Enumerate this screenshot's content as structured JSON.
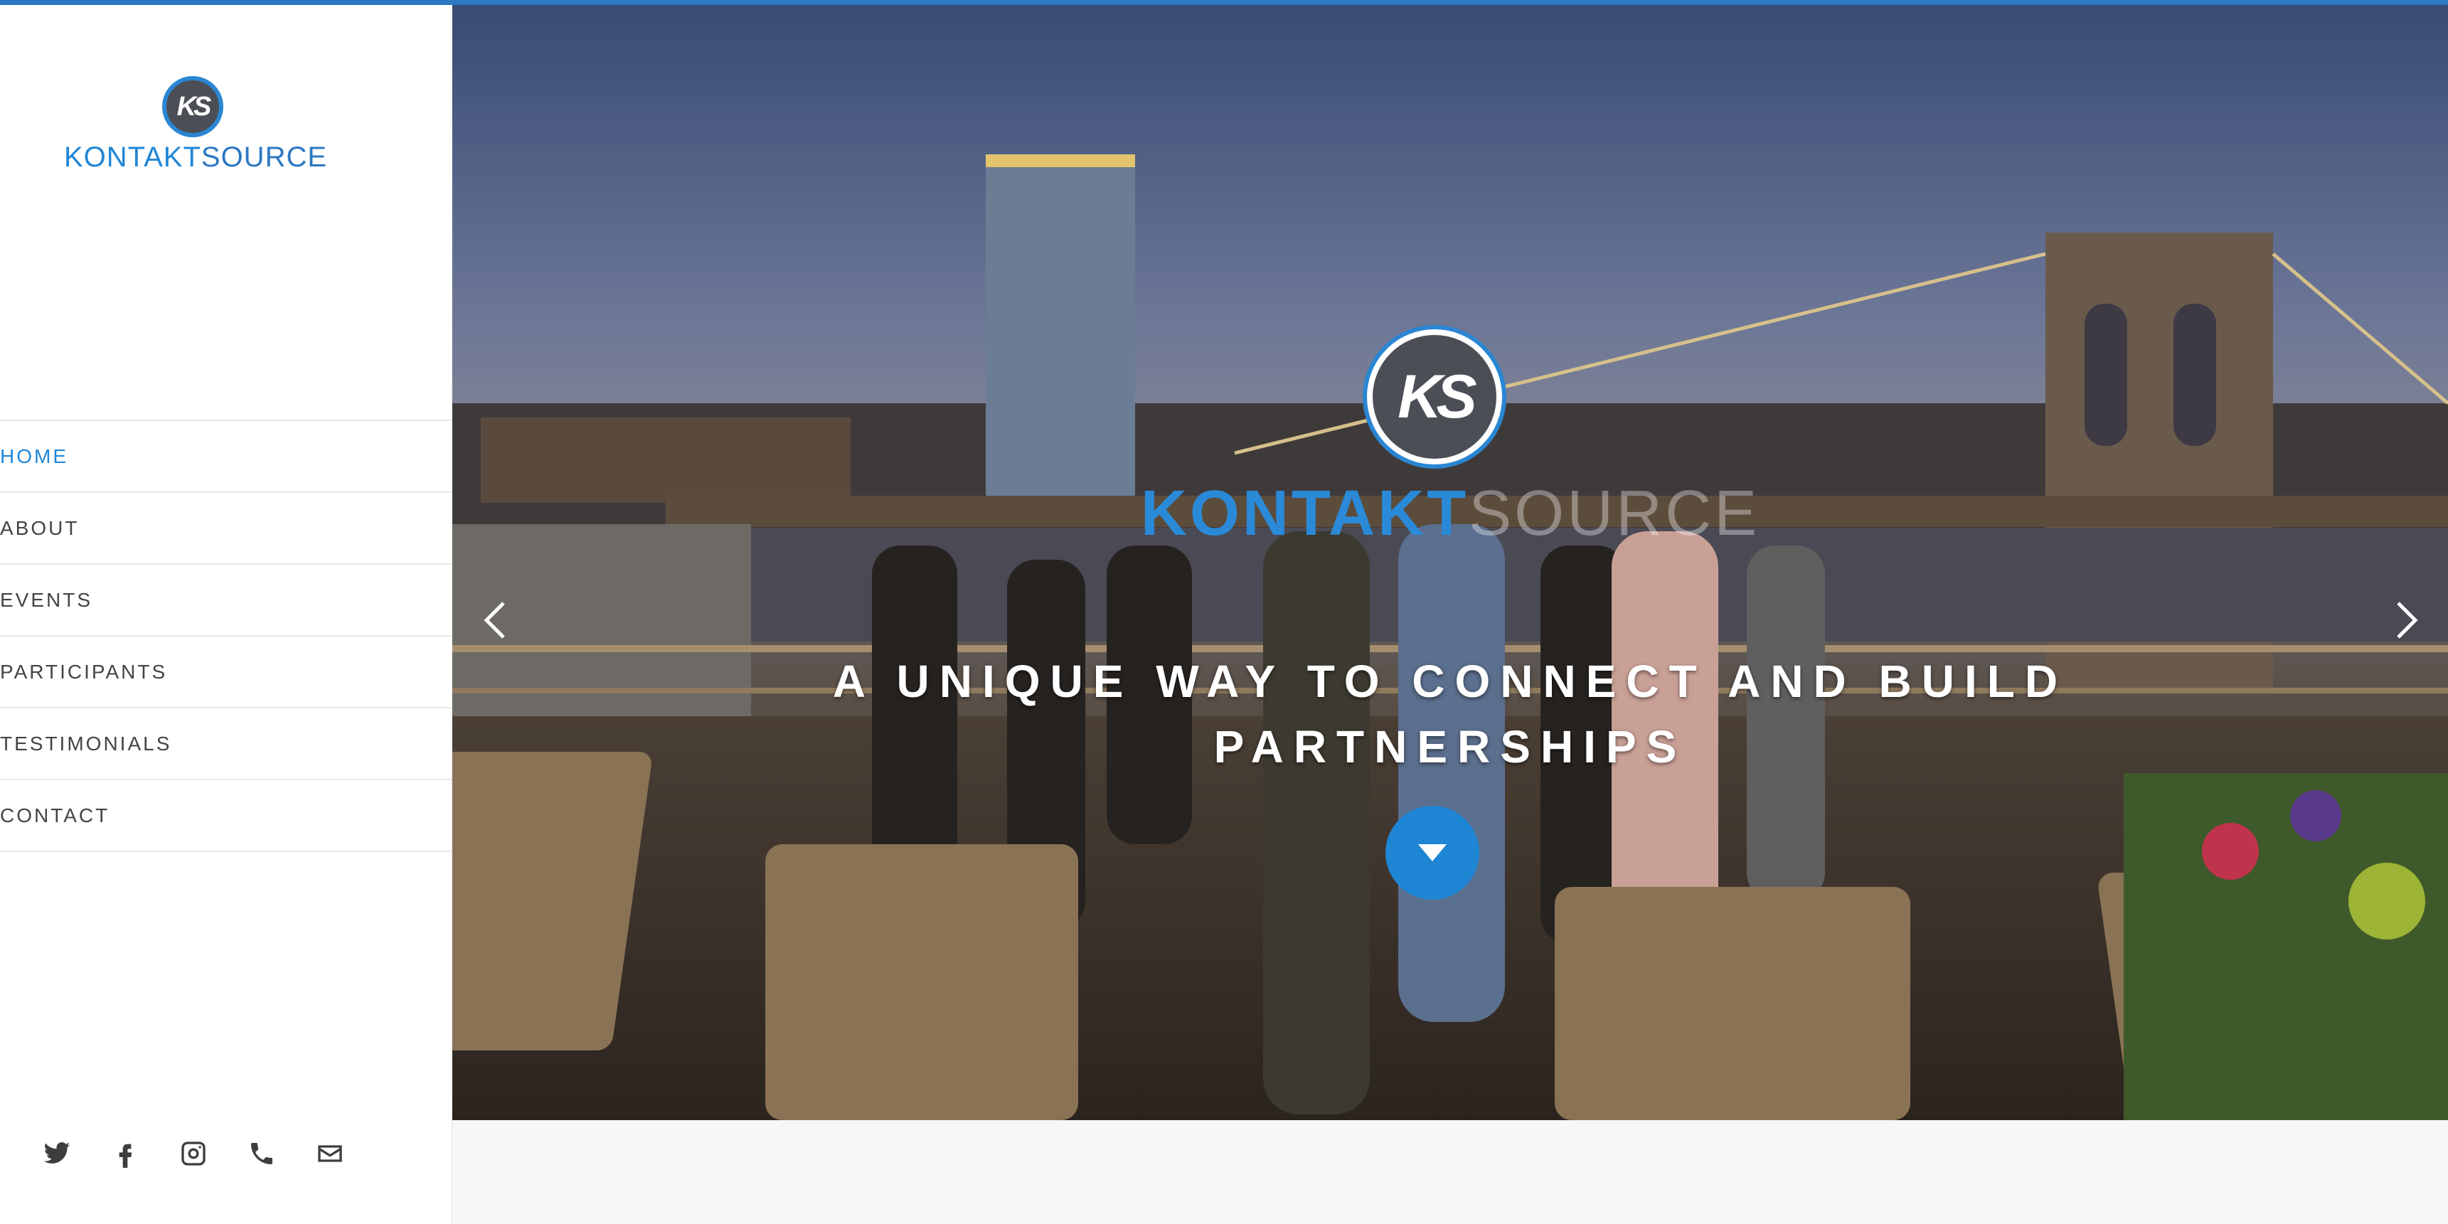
{
  "brand": {
    "mark": "KS",
    "name_part1": "KONTAKT",
    "name_part2": "SOURCE",
    "accent_color": "#1f86d6"
  },
  "nav": {
    "items": [
      {
        "label": "HOME",
        "active": true
      },
      {
        "label": "ABOUT",
        "active": false
      },
      {
        "label": "EVENTS",
        "active": false
      },
      {
        "label": "PARTICIPANTS",
        "active": false
      },
      {
        "label": "TESTIMONIALS",
        "active": false
      },
      {
        "label": "CONTACT",
        "active": false
      }
    ]
  },
  "social": {
    "icons": [
      "twitter-icon",
      "facebook-icon",
      "instagram-icon",
      "phone-icon",
      "email-icon"
    ]
  },
  "hero": {
    "heading": "A UNIQUE WAY TO CONNECT AND BUILD PARTNERSHIPS",
    "prev_icon": "chevron-left-icon",
    "next_icon": "chevron-right-icon",
    "scroll_icon": "caret-down-icon"
  }
}
